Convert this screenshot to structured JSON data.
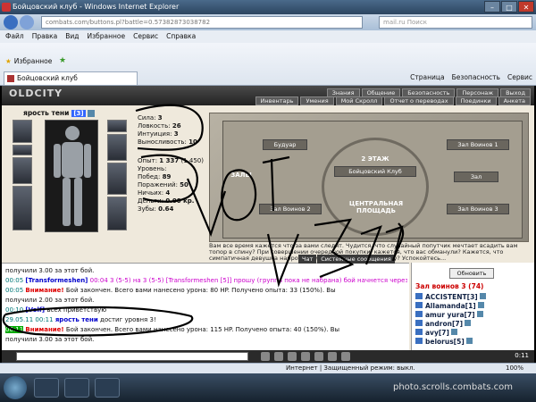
{
  "browser": {
    "title": "Бойцовский клуб - Windows Internet Explorer",
    "address": "combats.com/buttons.pl?battle=0.57382873038782",
    "search": "mail.ru Поиск"
  },
  "menu": [
    "Файл",
    "Правка",
    "Вид",
    "Избранное",
    "Сервис",
    "Справка"
  ],
  "favorites": {
    "label": "Избранное"
  },
  "tab": {
    "label": "Бойцовский клуб"
  },
  "tools": [
    "Страница",
    "Безопасность",
    "Сервис"
  ],
  "game": {
    "logo": "OLDCITY",
    "nav_top": [
      "Знания",
      "Общение",
      "Безопасность",
      "Персонаж",
      "Выход"
    ],
    "nav_sub": [
      "Инвентарь",
      "Умения",
      "Мой Скролл",
      "Отчет о переводах",
      "Поединки",
      "Анкета"
    ]
  },
  "character": {
    "name": "ярость тени",
    "level": "[3]"
  },
  "stats": [
    {
      "label": "Сила:",
      "value": "3"
    },
    {
      "label": "Ловкость:",
      "value": "26"
    },
    {
      "label": "Интуиция:",
      "value": "3"
    },
    {
      "label": "Выносливость:",
      "value": "10"
    }
  ],
  "progress": [
    {
      "label": "Опыт:",
      "value": "1 337",
      "extra": "(1 450)"
    },
    {
      "label": "Уровень:",
      "value": ""
    },
    {
      "label": "Побед:",
      "value": "89"
    },
    {
      "label": "Поражений:",
      "value": "50"
    },
    {
      "label": "Ничьих:",
      "value": "4"
    },
    {
      "label": "Деньги:",
      "value": "0.00 кр."
    },
    {
      "label": "Зубы:",
      "value": "0.64"
    }
  ],
  "lobby": {
    "rooms": [
      "Будуар",
      "Зал Воинов 1",
      "Зал Воинов 2",
      "Зал Воинов 3",
      "Зал"
    ],
    "center_top": "2 ЭТАЖ",
    "center": "Бойцовский Клуб",
    "center_bottom": "ЦЕНТРАЛЬНАЯ ПЛОЩАДЬ",
    "left_label": "ЗАЛЫ"
  },
  "story": "Вам все время кажется что за вами следят. Чудится, что случайный попутчик мечтает всадить вам топор в спину? При совершении очередной покупки, кажется, что вас обманули? Кажется, что симпатичная девушка напротив смотрит на вас как на пищу? Успокойтесь...",
  "chat": {
    "tabs": [
      "Чат",
      "Системные сообщения"
    ],
    "lines": [
      {
        "pre": "получили",
        "body": "3.00 за этот бой.",
        "time": "",
        "nick": "",
        "cls": ""
      },
      {
        "time": "00:05",
        "nick": "[Transformeshen]",
        "body": "00:04 3 (5-5) на 3 (5-5) [Transformeshen [5]] прошу (группа пока не набрана) бой начнется через 4.1 мин., таймаут 1 мин.",
        "pre": "",
        "cls": "mag"
      },
      {
        "time": "00:05",
        "nick": "",
        "pre": "Внимание!",
        "body": "Бой закончен. Всего вами нанесено урона: 80 HP. Получено опыта: 33 (150%). Вы",
        "cls": "warn"
      },
      {
        "pre": "получили",
        "body": "2.00 за этот бой.",
        "time": "",
        "nick": "",
        "cls": ""
      },
      {
        "time": "00:10",
        "nick": "[Volf]",
        "body": "всех приветствую",
        "pre": "",
        "cls": ""
      },
      {
        "time": "29.05.11 00:11",
        "nick": "ярость тени",
        "body": "достиг уровня 3!",
        "pre": "",
        "cls": ""
      },
      {
        "time": "00:11",
        "nick": "",
        "pre": "Внимание!",
        "body": "Бой закончен. Всего вами нанесено урона: 115 HP. Получено опыта: 40 (150%). Вы",
        "cls": "warn"
      },
      {
        "pre": "получили",
        "body": "3.00 за этот бой.",
        "time": "",
        "nick": "",
        "cls": ""
      }
    ]
  },
  "sidebar": {
    "refresh": "Обновить",
    "room": "Зал воинов 3 (74)",
    "users": [
      "ACCISTENT[3]",
      "Allamanda[1]",
      "amur yura[7]",
      "andron[7]",
      "avy[7]",
      "belorus[5]"
    ]
  },
  "statusbar": {
    "zone": "Интернет | Защищенный режим: выкл.",
    "zoom": "100%"
  },
  "clock": "0:11",
  "watermark": "photo.scrolls.combats.com"
}
